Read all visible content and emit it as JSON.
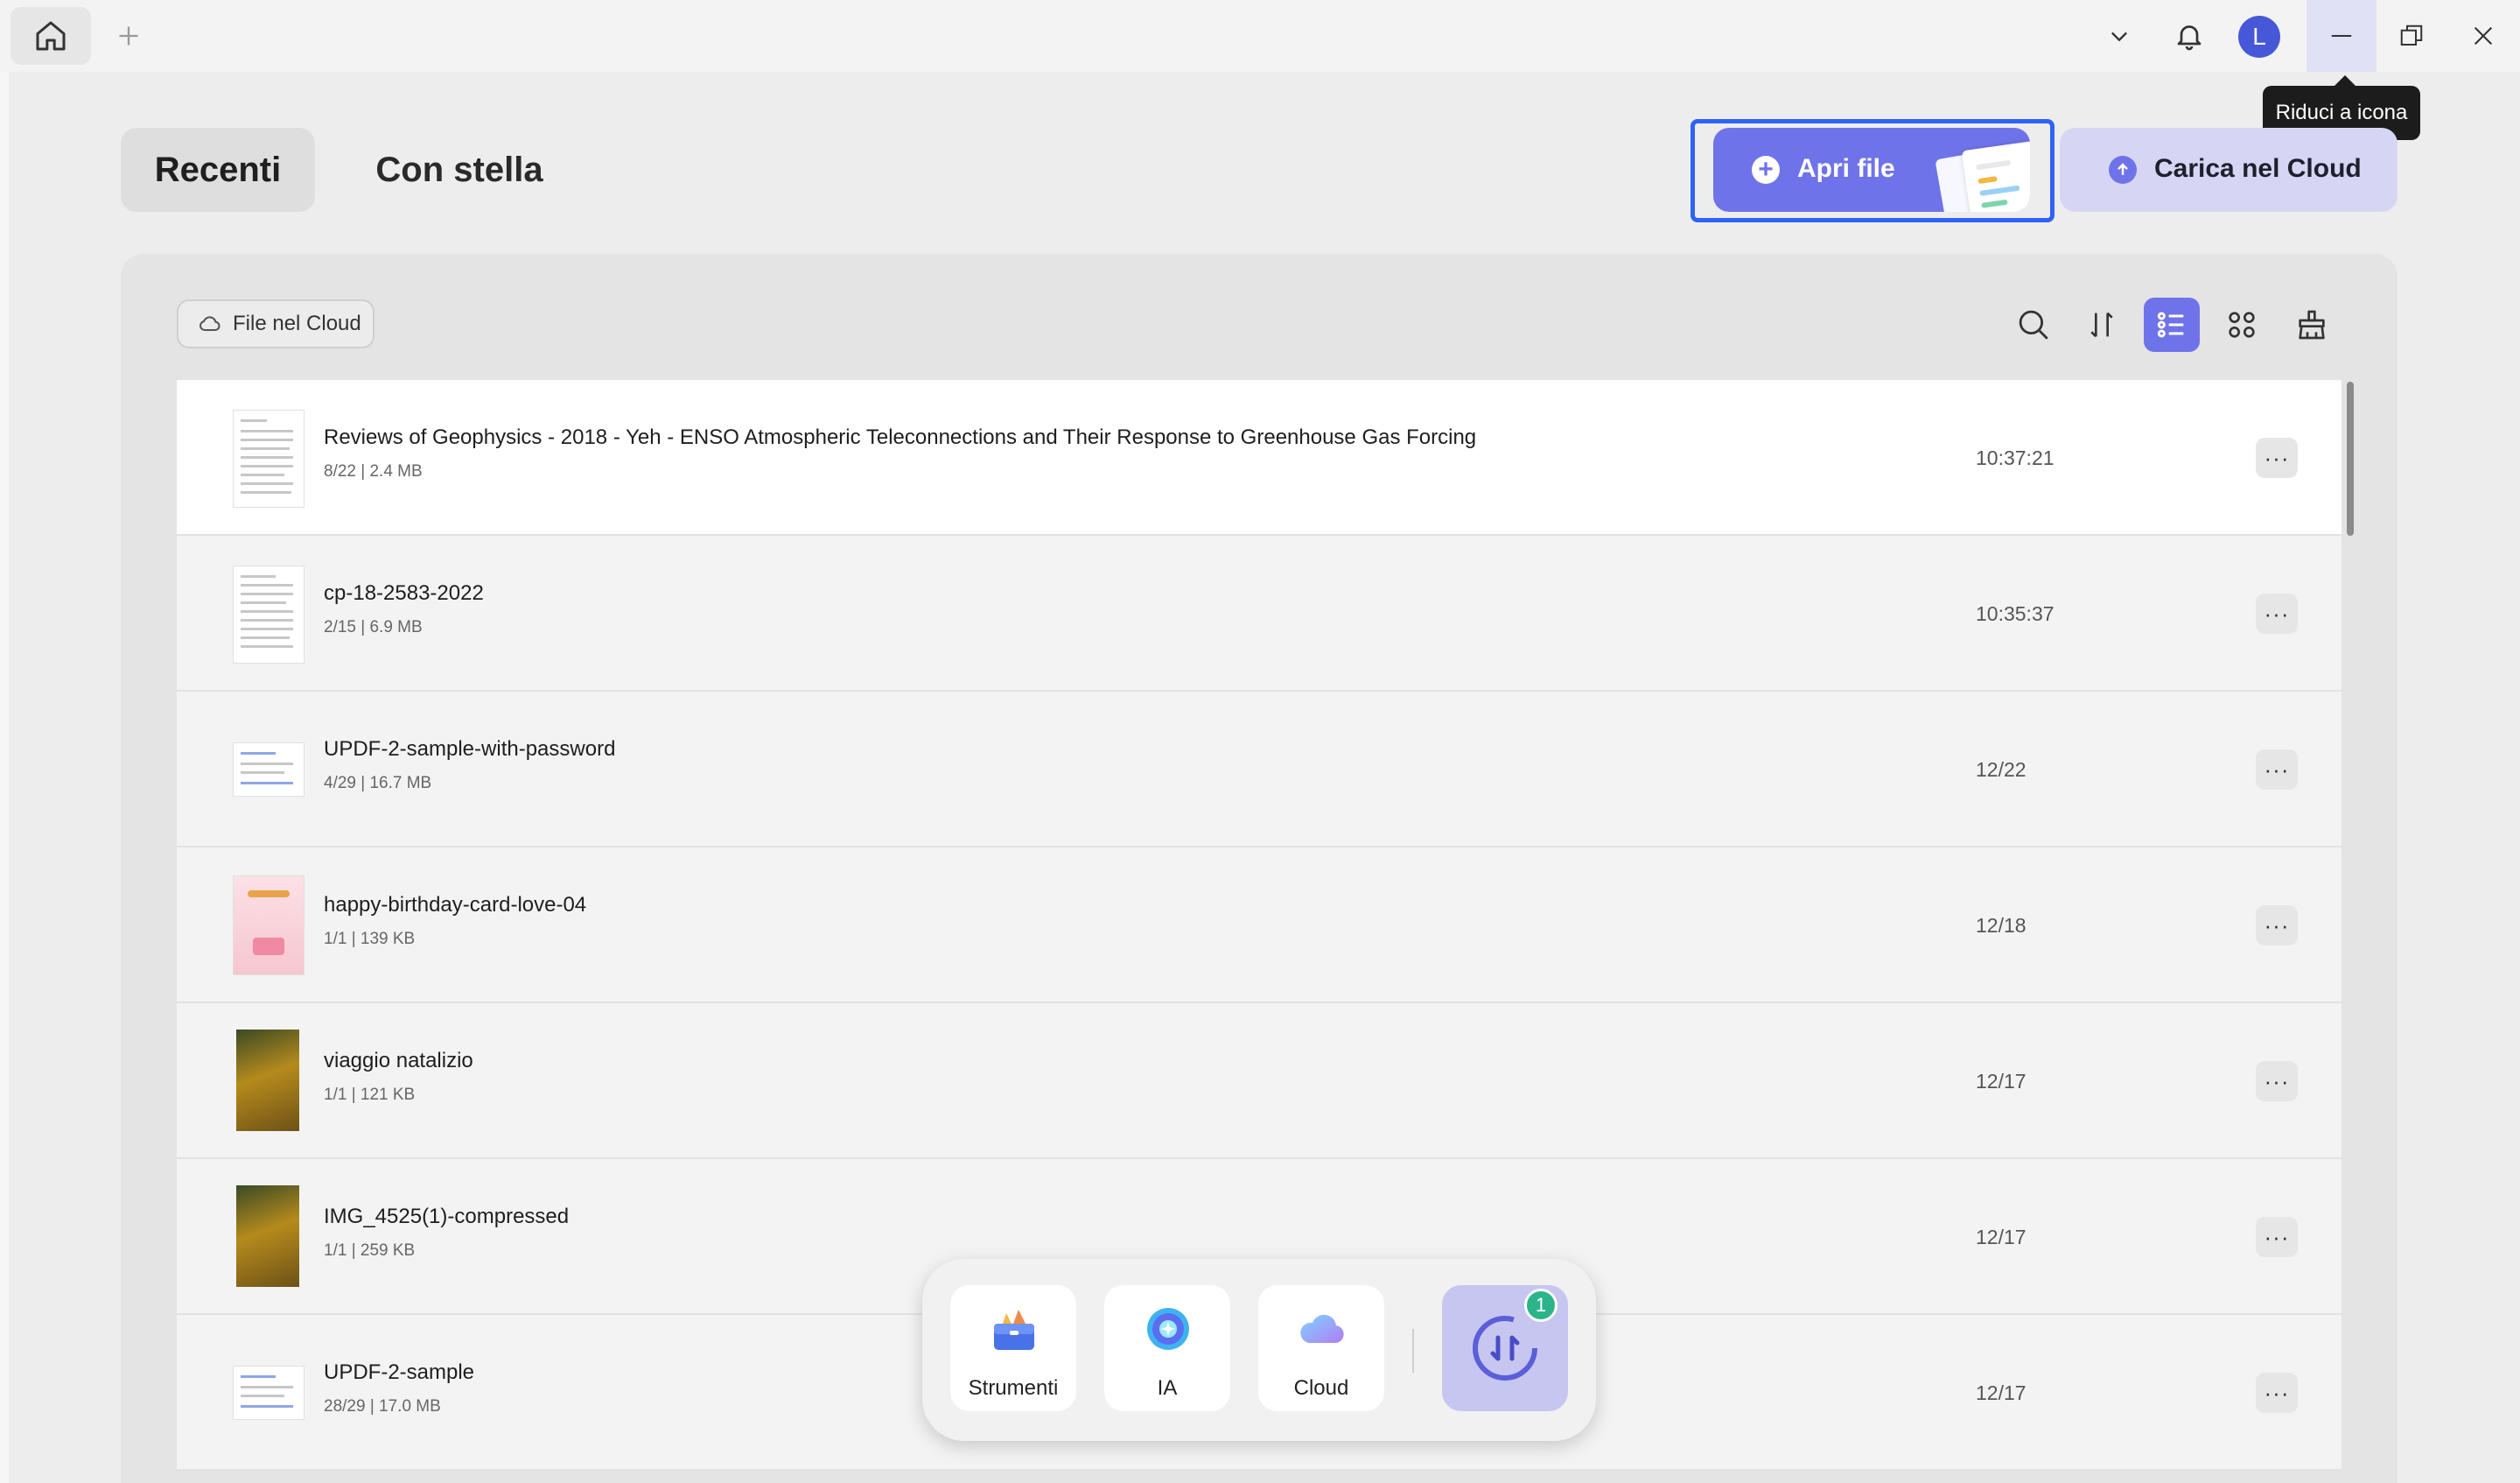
{
  "titlebar": {
    "avatar_letter": "L",
    "tooltip": "Riduci a icona"
  },
  "tabs": {
    "recent": "Recenti",
    "starred": "Con stella"
  },
  "actions": {
    "open_file": "Apri file",
    "upload_cloud": "Carica nel Cloud"
  },
  "filter": {
    "cloud_files": "File nel Cloud"
  },
  "files": [
    {
      "name": "Reviews of Geophysics - 2018 - Yeh - ENSO Atmospheric Teleconnections and Their Response to Greenhouse Gas Forcing",
      "meta": "8/22 | 2.4 MB",
      "time": "10:37:21"
    },
    {
      "name": "cp-18-2583-2022",
      "meta": "2/15 | 6.9 MB",
      "time": "10:35:37"
    },
    {
      "name": "UPDF-2-sample-with-password",
      "meta": "4/29 | 16.7 MB",
      "time": "12/22"
    },
    {
      "name": "happy-birthday-card-love-04",
      "meta": "1/1 | 139 KB",
      "time": "12/18"
    },
    {
      "name": "viaggio natalizio",
      "meta": "1/1 | 121 KB",
      "time": "12/17"
    },
    {
      "name": "IMG_4525(1)-compressed",
      "meta": "1/1 | 259 KB",
      "time": "12/17"
    },
    {
      "name": "UPDF-2-sample",
      "meta": "28/29 | 17.0 MB",
      "time": "12/17"
    }
  ],
  "dock": {
    "tools": "Strumenti",
    "ai": "IA",
    "cloud": "Cloud",
    "badge_count": "1"
  },
  "colors": {
    "accent": "#6f73ea",
    "focus_ring": "#2f62f5",
    "badge": "#2bb489",
    "avatar": "#4658d8"
  }
}
